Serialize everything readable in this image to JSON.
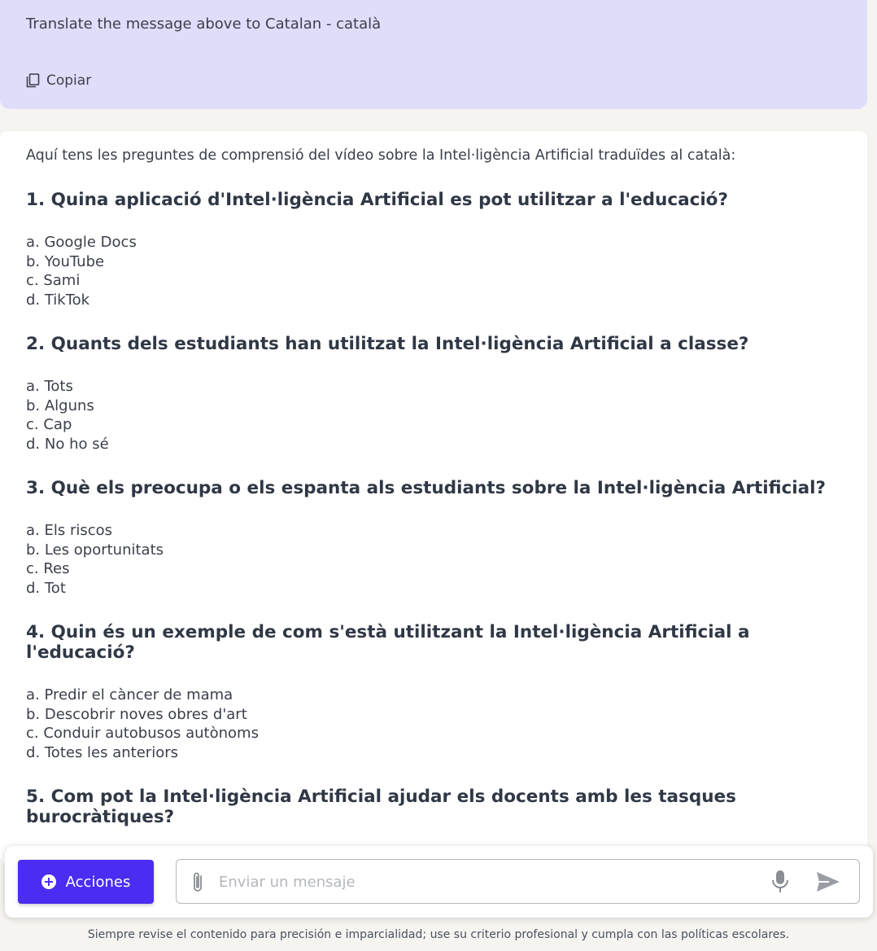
{
  "user_message": {
    "text": "Translate the message above to Catalan - català",
    "copy_label": "Copiar"
  },
  "ai_message": {
    "intro": "Aquí tens les preguntes de comprensió del vídeo sobre la Intel·ligència Artificial traduïdes al català:",
    "questions": [
      {
        "title": "1. Quina aplicació d'Intel·ligència Artificial es pot utilitzar a l'educació?",
        "options": [
          "a. Google Docs",
          "b. YouTube",
          "c. Sami",
          "d. TikTok"
        ]
      },
      {
        "title": "2. Quants dels estudiants han utilitzat la Intel·ligència Artificial a classe?",
        "options": [
          "a. Tots",
          "b. Alguns",
          "c. Cap",
          "d. No ho sé"
        ]
      },
      {
        "title": "3. Què els preocupa o els espanta als estudiants sobre la Intel·ligència Artificial?",
        "options": [
          "a. Els riscos",
          "b. Les oportunitats",
          "c. Res",
          "d. Tot"
        ]
      },
      {
        "title": "4. Quin és un exemple de com s'està utilitzant la Intel·ligència Artificial a l'educació?",
        "options": [
          "a. Predir el càncer de mama",
          "b. Descobrir noves obres d'art",
          "c. Conduir autobusos autònoms",
          "d. Totes les anteriors"
        ]
      },
      {
        "title": "5. Com pot la Intel·ligència Artificial ajudar els docents amb les tasques burocràtiques?",
        "options": []
      }
    ]
  },
  "composer": {
    "actions_label": "Acciones",
    "input_placeholder": "Enviar un mensaje",
    "input_value": ""
  },
  "disclaimer": "Siempre revise el contenido para precisión e imparcialidad; use su criterio profesional y cumpla con las políticas escolares.",
  "colors": {
    "user_bubble": "#e0ddfb",
    "accent": "#4a2df0",
    "page_bg": "#f5f4f0"
  }
}
